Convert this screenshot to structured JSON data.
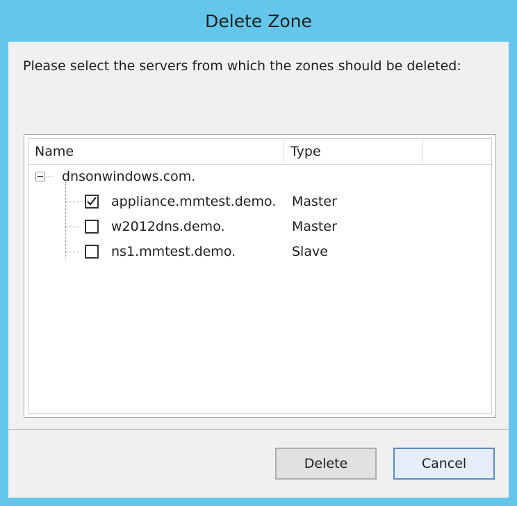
{
  "window": {
    "title": "Delete Zone",
    "accent_color": "#64c6ea"
  },
  "instruction": "Please select the servers from which the zones should be deleted:",
  "tree": {
    "columns": [
      "Name",
      "Type"
    ],
    "root": {
      "label": "dnsonwindows.com.",
      "expanded": true,
      "expander_icon": "collapse-minus-icon"
    },
    "servers": [
      {
        "name": "appliance.mmtest.demo.",
        "type": "Master",
        "checked": true
      },
      {
        "name": "w2012dns.demo.",
        "type": "Master",
        "checked": false
      },
      {
        "name": "ns1.mmtest.demo.",
        "type": "Slave",
        "checked": false
      }
    ]
  },
  "buttons": {
    "delete_label": "Delete",
    "cancel_label": "Cancel"
  }
}
